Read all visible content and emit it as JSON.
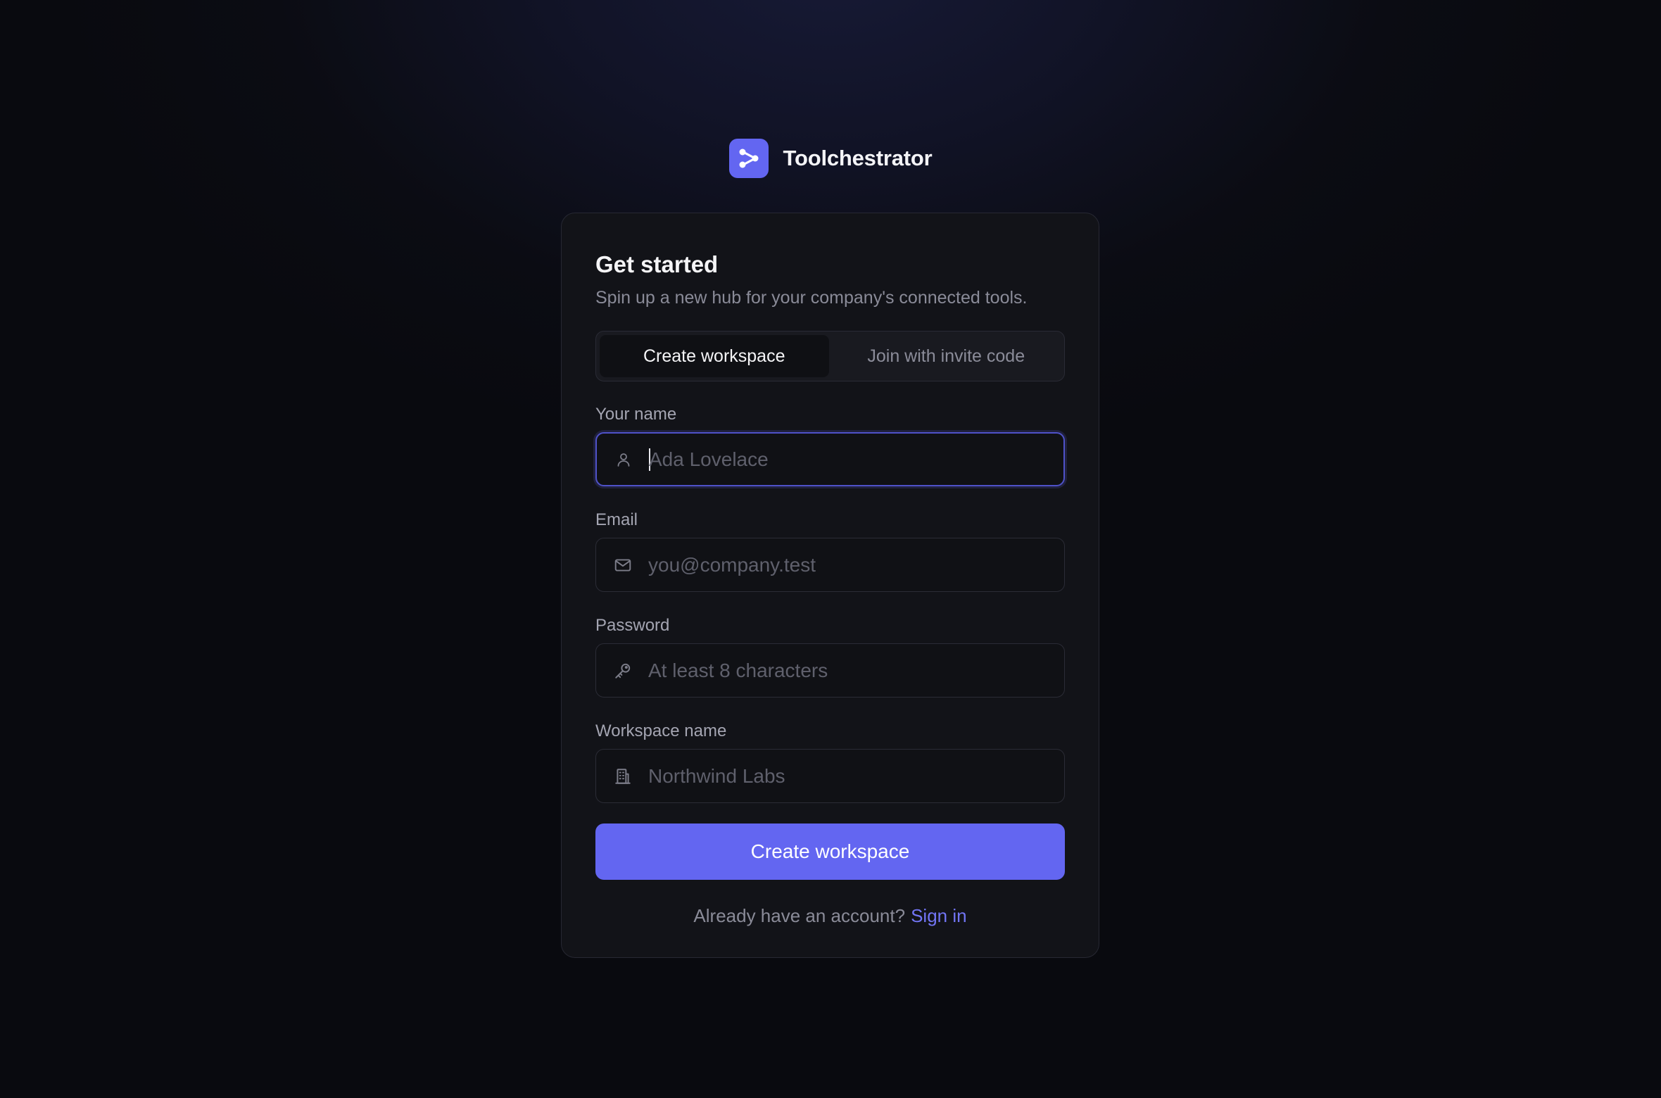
{
  "brand": {
    "name": "Toolchestrator",
    "logo_color": "#6366f1"
  },
  "card": {
    "title": "Get started",
    "subtitle": "Spin up a new hub for your company's connected tools."
  },
  "tabs": [
    {
      "label": "Create workspace",
      "active": true
    },
    {
      "label": "Join with invite code",
      "active": false
    }
  ],
  "fields": {
    "name": {
      "label": "Your name",
      "placeholder": "Ada Lovelace",
      "value": "",
      "icon": "user-icon",
      "focused": true
    },
    "email": {
      "label": "Email",
      "placeholder": "you@company.test",
      "value": "",
      "icon": "mail-icon"
    },
    "password": {
      "label": "Password",
      "placeholder": "At least 8 characters",
      "value": "",
      "icon": "key-icon"
    },
    "workspace": {
      "label": "Workspace name",
      "placeholder": "Northwind Labs",
      "value": "",
      "icon": "building-icon"
    }
  },
  "submit": {
    "label": "Create workspace",
    "color": "#6366f1"
  },
  "footer": {
    "prompt": "Already have an account?",
    "link_label": "Sign in",
    "link_color": "#7275f4"
  }
}
